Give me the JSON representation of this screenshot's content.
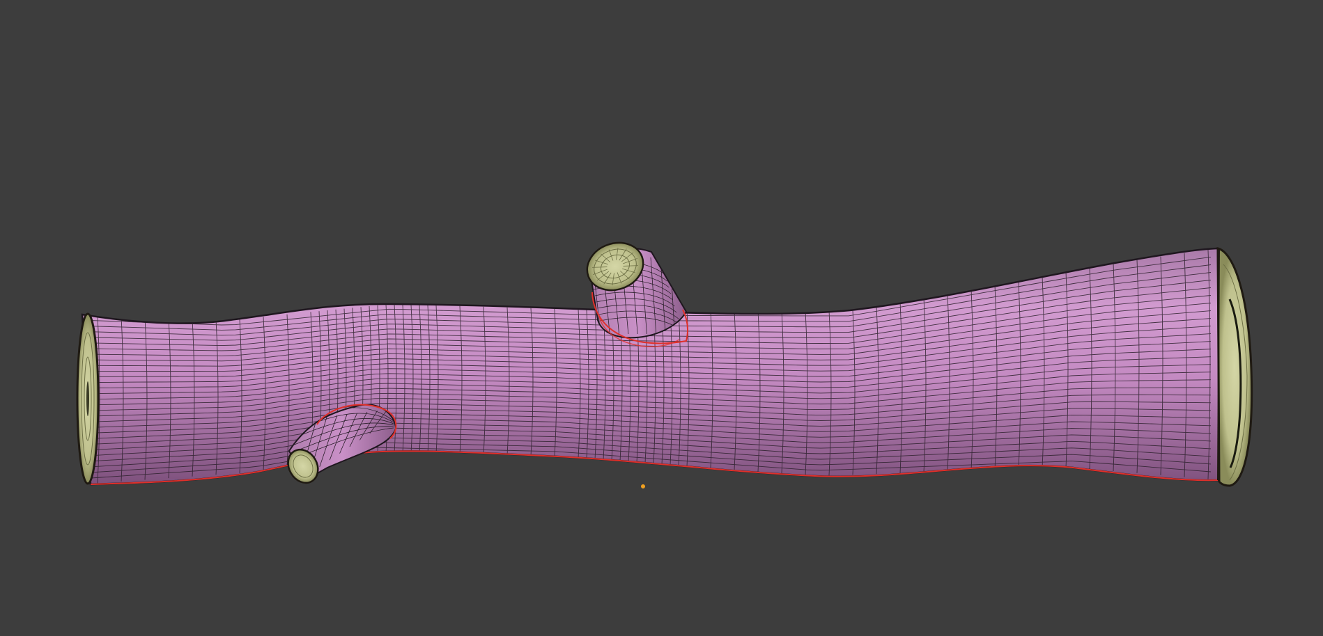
{
  "viewport": {
    "background_color": "#3d3d3d"
  },
  "mesh": {
    "object": "tree-branch-log",
    "shading": "solid-with-wireframe",
    "surface_color": "#c58bc3",
    "surface_shadow_color": "#8a5a89",
    "cap_color": "#c6c896",
    "cap_ring_color": "#8f915e",
    "wire_color": "#2a1f2a",
    "seam_color": "#e0302a"
  },
  "origin_marker": {
    "color": "#f0a020"
  }
}
